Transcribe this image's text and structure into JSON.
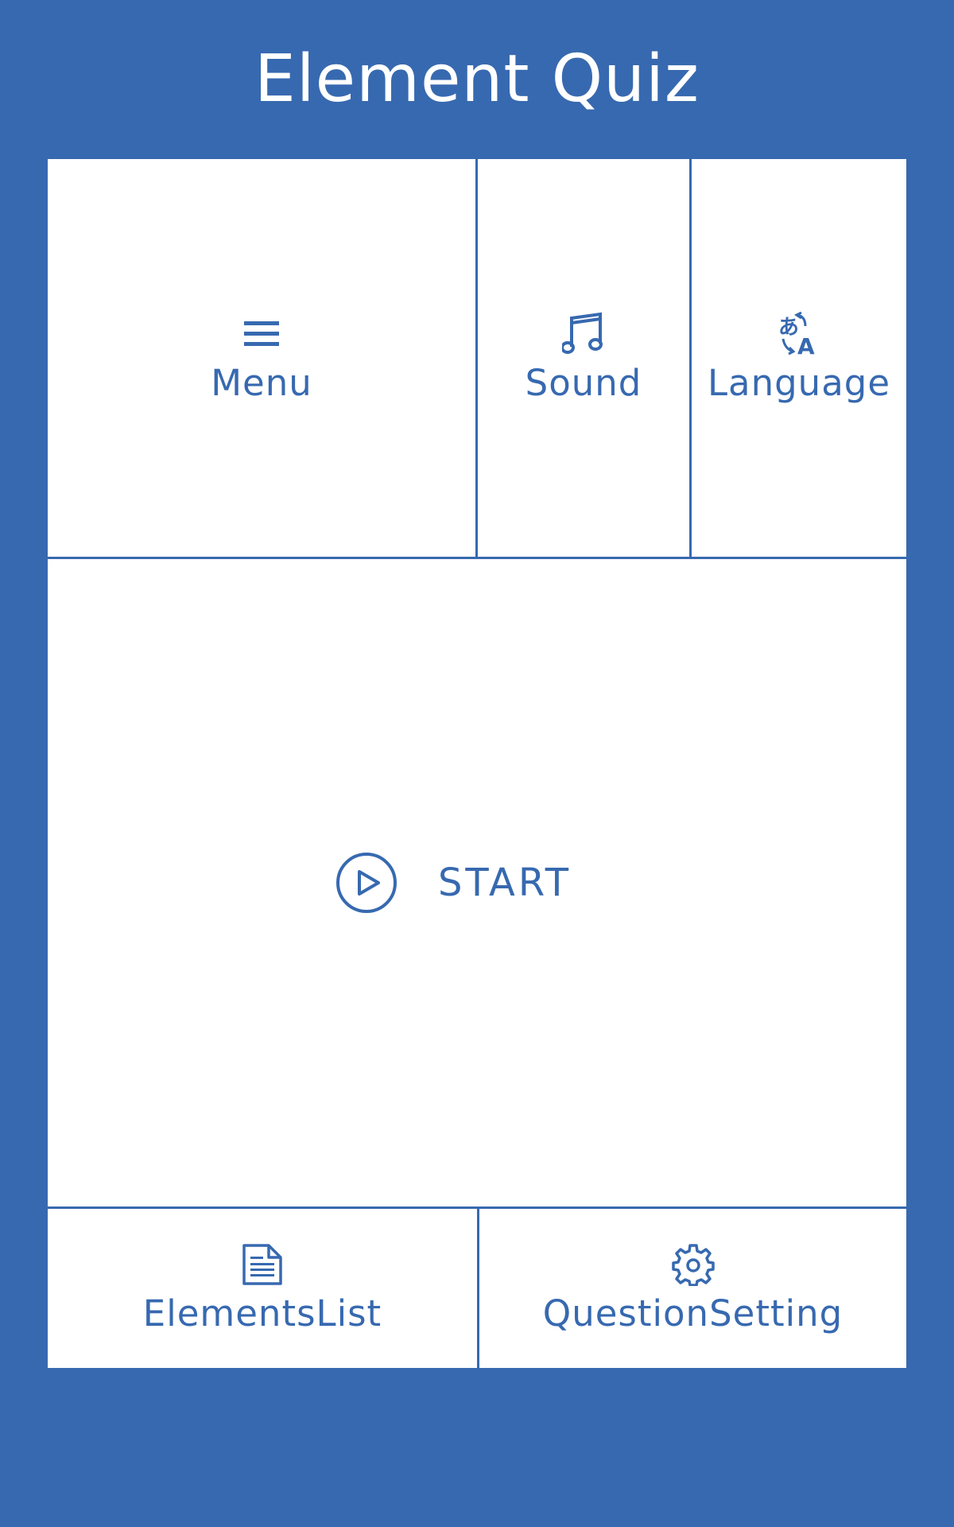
{
  "app": {
    "title": "Element Quiz"
  },
  "top_row": {
    "menu": {
      "label": "Menu",
      "icon": "hamburger-menu-icon"
    },
    "sound": {
      "label": "Sound",
      "icon": "music-note-icon"
    },
    "language": {
      "label": "Language",
      "icon": "translate-icon"
    }
  },
  "start": {
    "label": "START",
    "icon": "play-circle-icon"
  },
  "bottom_row": {
    "elements_list": {
      "label": "ElementsList",
      "icon": "document-icon"
    },
    "question_setting": {
      "label": "QuestionSetting",
      "icon": "gear-icon"
    }
  },
  "colors": {
    "accent": "#3769b0",
    "panel": "#ffffff"
  }
}
